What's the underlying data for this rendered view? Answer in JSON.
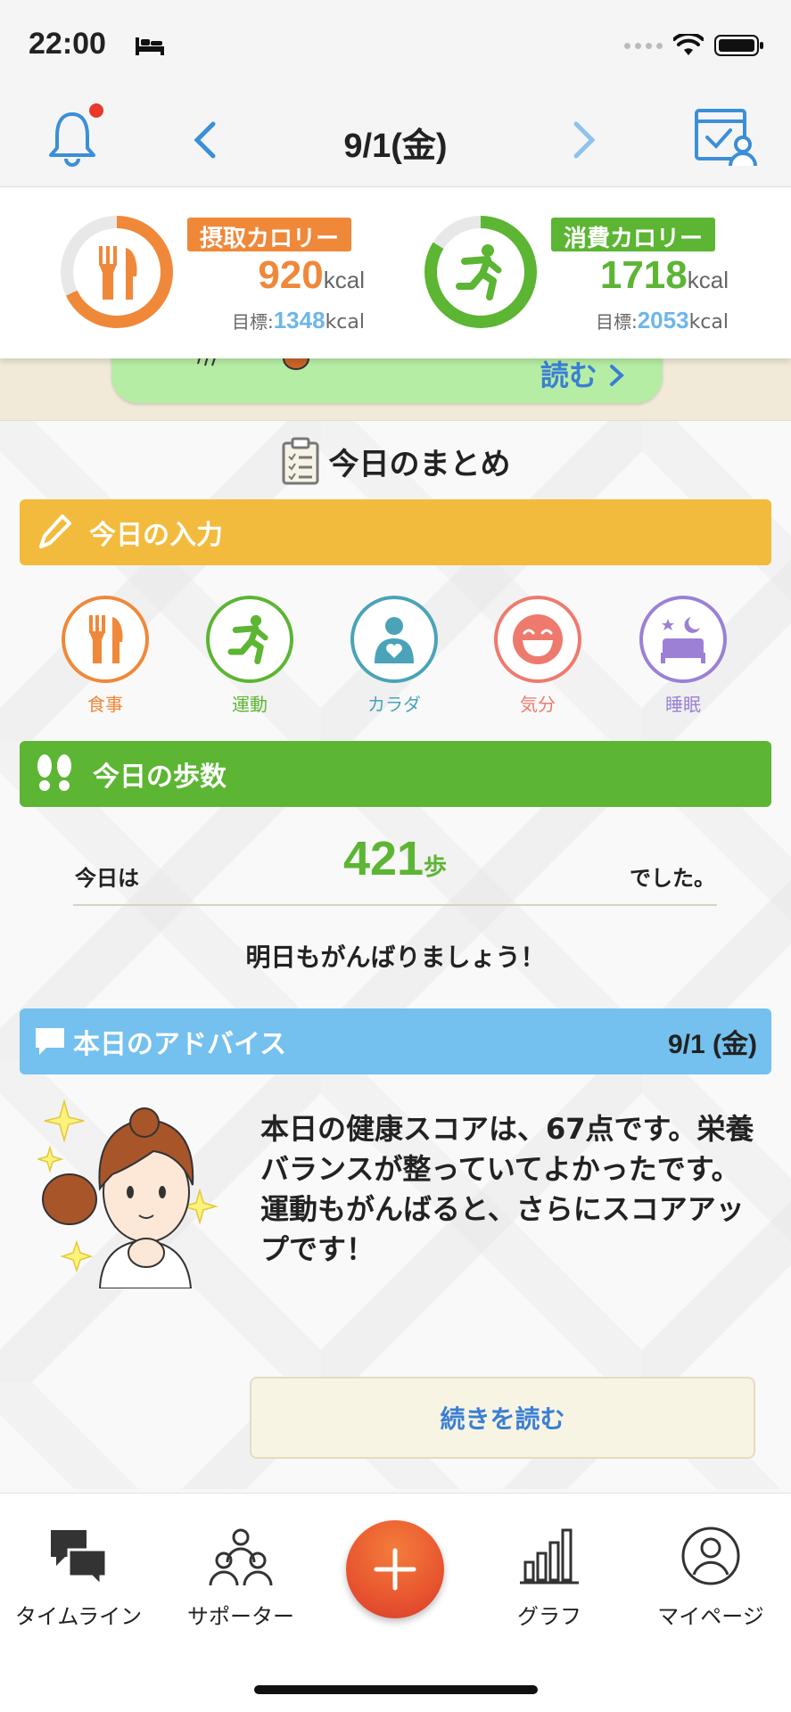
{
  "status": {
    "time": "22:00"
  },
  "nav": {
    "date": "9/1(金)"
  },
  "calories": {
    "intake": {
      "label": "摂取カロリー",
      "value": "920",
      "unit": "kcal",
      "goal_label": "目標:",
      "goal_value": "1348",
      "goal_unit": "kcal",
      "color": "#f0883a",
      "ring_fraction": 0.68
    },
    "burned": {
      "label": "消費カロリー",
      "value": "1718",
      "unit": "kcal",
      "goal_label": "目標:",
      "goal_value": "2053",
      "goal_unit": "kcal",
      "color": "#5cb533",
      "ring_fraction": 0.84
    }
  },
  "banner": {
    "read_label": "読む"
  },
  "summary": {
    "title": "今日のまとめ"
  },
  "today_input": {
    "title": "今日の入力",
    "color": "#f3bb3d",
    "items": [
      {
        "label": "食事",
        "color": "#f0883a"
      },
      {
        "label": "運動",
        "color": "#5cb533"
      },
      {
        "label": "カラダ",
        "color": "#4aa3b8"
      },
      {
        "label": "気分",
        "color": "#ee7a6d"
      },
      {
        "label": "睡眠",
        "color": "#9b80d6"
      }
    ]
  },
  "steps": {
    "title": "今日の歩数",
    "color": "#5cb533",
    "prefix": "今日は",
    "value": "421",
    "unit": "歩",
    "suffix": "でした。",
    "message": "明日もがんばりましょう！"
  },
  "advice": {
    "title": "本日のアドバイス",
    "date": "9/1 (金)",
    "color": "#74c0ee",
    "text": "本日の健康スコアは、67点です。栄養バランスが整っていてよかったです。運動もがんばると、さらにスコアアップです！",
    "read_more": "続きを読む"
  },
  "tabs": [
    {
      "label": "タイムライン",
      "icon": "chat-bubbles-icon"
    },
    {
      "label": "サポーター",
      "icon": "people-icon"
    },
    {
      "label": "",
      "icon": "plus-icon"
    },
    {
      "label": "グラフ",
      "icon": "bar-graph-icon"
    },
    {
      "label": "マイページ",
      "icon": "user-icon"
    }
  ]
}
